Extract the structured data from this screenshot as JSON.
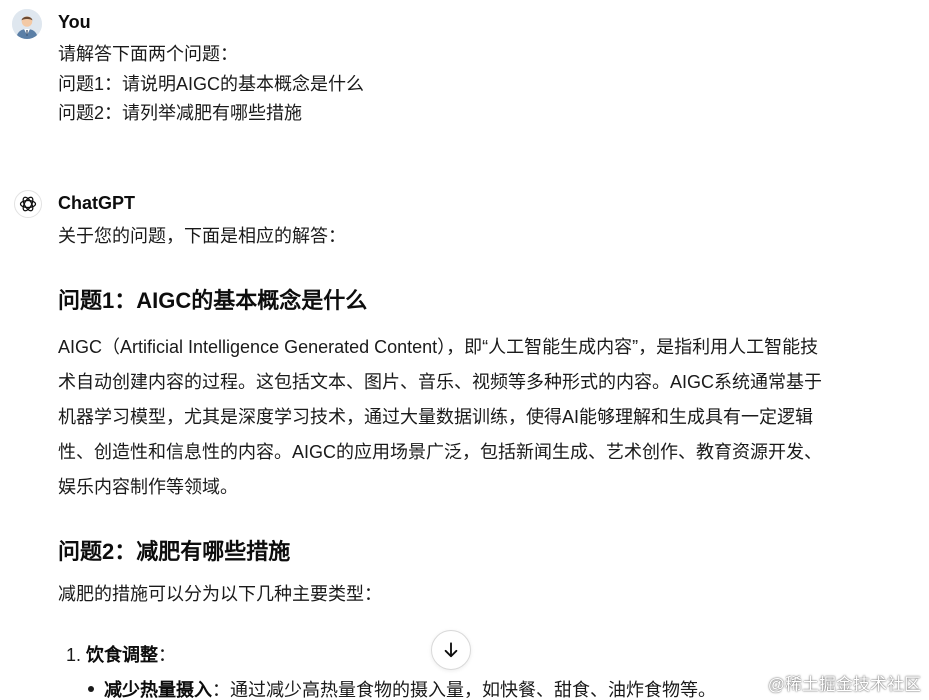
{
  "user": {
    "name": "You",
    "avatar_icon": "user-avatar-icon",
    "lines": [
      "请解答下面两个问题：",
      "问题1：请说明AIGC的基本概念是什么",
      "问题2：请列举减肥有哪些措施"
    ]
  },
  "assistant": {
    "name": "ChatGPT",
    "avatar_icon": "openai-logo-icon",
    "intro": "关于您的问题，下面是相应的解答：",
    "section1": {
      "heading": "问题1：AIGC的基本概念是什么",
      "paragraph_lines": [
        "AIGC（Artificial Intelligence Generated Content），即“人工智能生成内容”，是指利用人工智能技",
        "术自动创建内容的过程。这包括文本、图片、音乐、视频等多种形式的内容。AIGC系统通常基于",
        "机器学习模型，尤其是深度学习技术，通过大量数据训练，使得AI能够理解和生成具有一定逻辑",
        "性、创造性和信息性的内容。AIGC的应用场景广泛，包括新闻生成、艺术创作、教育资源开发、",
        "娱乐内容制作等领域。"
      ]
    },
    "section2": {
      "heading": "问题2：减肥有哪些措施",
      "intro": "减肥的措施可以分为以下几种主要类型：",
      "list_item_1": {
        "number": "1.",
        "title": "饮食调整",
        "suffix": "："
      },
      "sub_item_1": {
        "title": "减少热量摄入",
        "text": "：通过减少高热量食物的摄入量，如快餐、甜食、油炸食物等。"
      }
    }
  },
  "scroll_button": {
    "icon": "arrow-down-icon"
  },
  "watermark": "@稀土掘金技术社区"
}
